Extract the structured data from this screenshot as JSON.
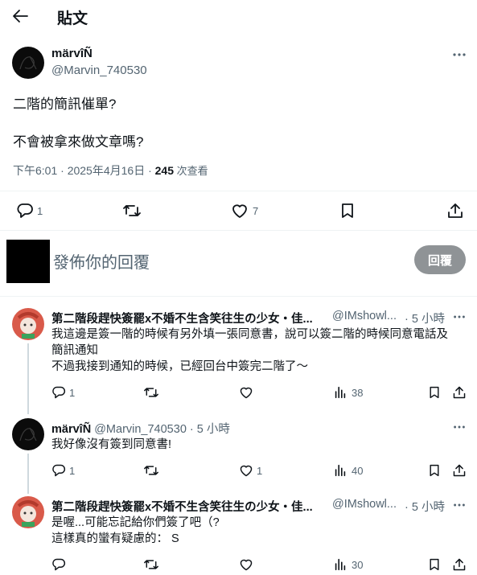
{
  "header": {
    "title": "貼文"
  },
  "post": {
    "display_name": "märvîÑ",
    "handle": "@Marvin_740530",
    "line1": "二階的簡訊催單?",
    "line2": "不會被拿來做文章嗎?",
    "time": "下午6:01 · 2025年4月16日 · ",
    "views_count": "245",
    "views_label": " 次查看",
    "replies": "1",
    "likes": "7"
  },
  "reply_box": {
    "placeholder": "發佈你的回覆",
    "button": "回覆"
  },
  "replies": [
    {
      "display_name": "第二階段趕快簽罷x不婚不生含笑往生の少女・佳...",
      "handle": "@IMshowl...",
      "time": "· 5 小時",
      "lines": [
        "我這邊是簽一階的時候有另外填一張同意書，說可以簽二階的時候同意電話及",
        "簡訊通知",
        "不過我接到通知的時候，已經回台中簽完二階了～"
      ],
      "reply_count": "1",
      "like_count": "",
      "views": "38"
    },
    {
      "display_name": "märvîÑ",
      "handle": "@Marvin_740530",
      "time": "· 5 小時",
      "lines": [
        "我好像沒有簽到同意書!"
      ],
      "reply_count": "1",
      "like_count": "1",
      "views": "40"
    },
    {
      "display_name": "第二階段趕快簽罷x不婚不生含笑往生の少女・佳...",
      "handle": "@IMshowl...",
      "time": "· 5 小時",
      "lines": [
        "是喔...可能忘記給你們簽了吧（?",
        "這樣真的蠻有疑慮的： S"
      ],
      "reply_count": "",
      "like_count": "",
      "views": "30"
    }
  ],
  "icons": {
    "back": "arrow-left-icon",
    "more": "more-horizontal-icon",
    "reply": "reply-bubble-icon",
    "retweet": "retweet-icon",
    "like": "heart-icon",
    "bookmark": "bookmark-icon",
    "share": "share-icon",
    "views": "views-bar-chart-icon"
  }
}
